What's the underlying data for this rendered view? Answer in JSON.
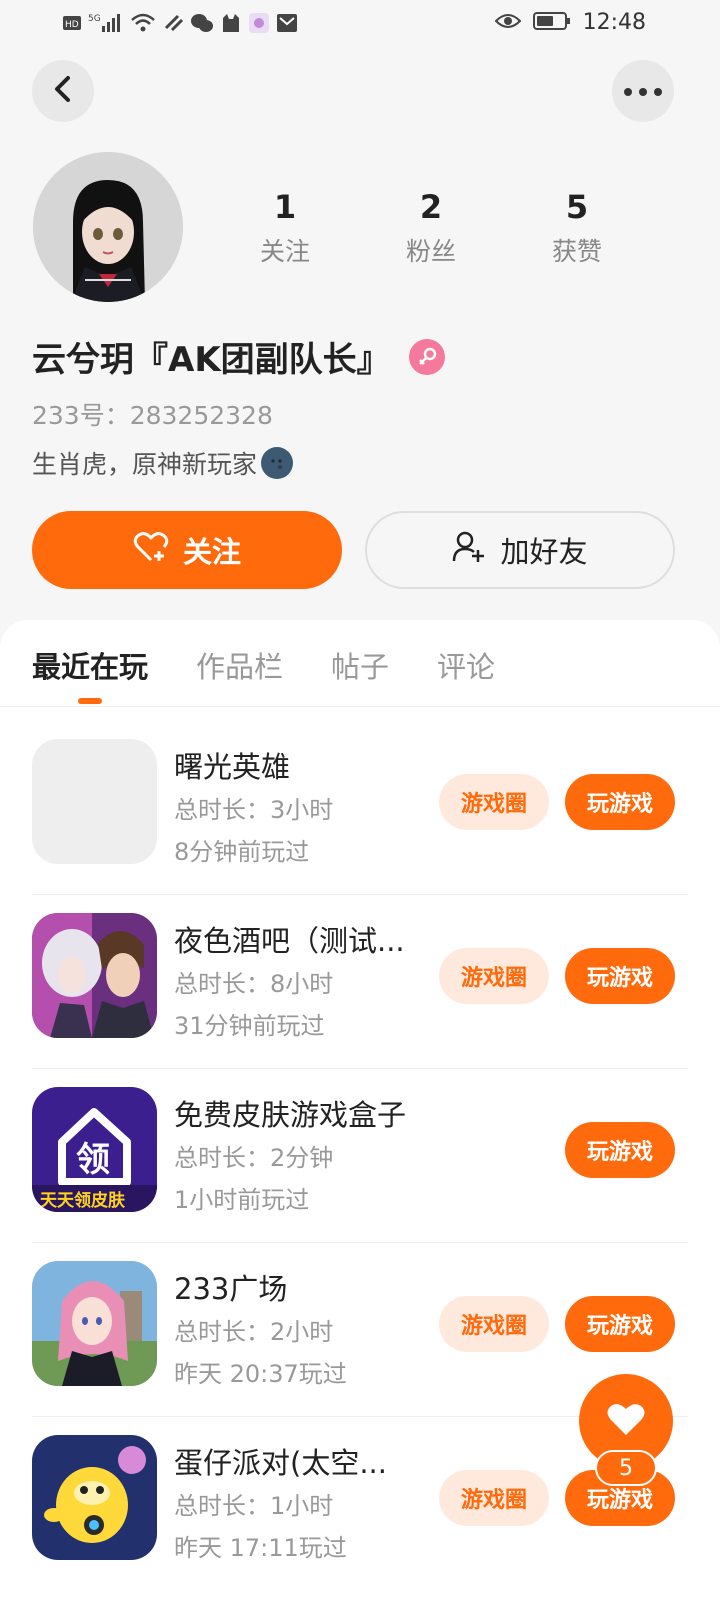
{
  "status_bar": {
    "time": "12:48",
    "network": "5G",
    "icons": [
      "hd-icon",
      "signal-icon",
      "wifi-icon",
      "link-icon",
      "wechat-icon",
      "cat-icon",
      "app-icon",
      "mail-icon",
      "eye-icon",
      "battery-icon"
    ]
  },
  "nav": {
    "back_icon": "chevron-left-icon",
    "more_icon": "more-dots-icon"
  },
  "profile": {
    "avatar": "anime-girl-avatar",
    "stats": [
      {
        "value": "1",
        "label": "关注"
      },
      {
        "value": "2",
        "label": "粉丝"
      },
      {
        "value": "5",
        "label": "获赞"
      }
    ],
    "username": "云兮玥『AK团副队长』",
    "gender_icon": "female-icon",
    "account_id": "233号：283252328",
    "bio": "生肖虎，原神新玩家"
  },
  "actions": {
    "follow_label": "关注",
    "add_friend_label": "加好友"
  },
  "tabs": [
    "最近在玩",
    "作品栏",
    "帖子",
    "评论"
  ],
  "games": [
    {
      "name": "曙光英雄",
      "duration": "总时长：3小时",
      "last_played": "8分钟前玩过",
      "circle_label": "游戏圈",
      "play_label": "玩游戏",
      "has_circle": true,
      "icon": "placeholder"
    },
    {
      "name": "夜色酒吧（测试...",
      "duration": "总时长：8小时",
      "last_played": "31分钟前玩过",
      "circle_label": "游戏圈",
      "play_label": "玩游戏",
      "has_circle": true,
      "icon": "anime-couple"
    },
    {
      "name": "免费皮肤游戏盒子",
      "duration": "总时长：2分钟",
      "last_played": "1小时前玩过",
      "circle_label": "",
      "play_label": "玩游戏",
      "has_circle": false,
      "icon": "skin-box",
      "icon_text": "天天领皮肤"
    },
    {
      "name": "233广场",
      "duration": "总时长：2小时",
      "last_played": "昨天 20:37玩过",
      "circle_label": "游戏圈",
      "play_label": "玩游戏",
      "has_circle": true,
      "icon": "plaza-girl"
    },
    {
      "name": "蛋仔派对(太空...",
      "duration": "总时长：1小时",
      "last_played": "昨天 17:11玩过",
      "circle_label": "游戏圈",
      "play_label": "玩游戏",
      "has_circle": true,
      "icon": "eggy"
    }
  ],
  "like_fab": {
    "count": "5",
    "icon": "heart-icon"
  },
  "colors": {
    "accent": "#ff6a0c",
    "accent_light": "#ffe9dc",
    "background": "#f6f6f6"
  }
}
